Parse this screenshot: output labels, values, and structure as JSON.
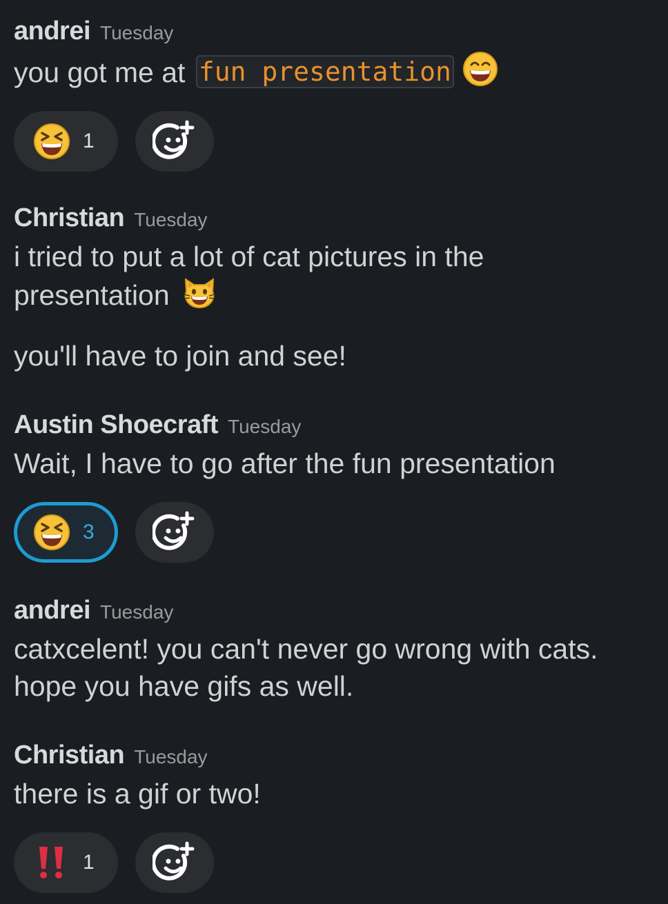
{
  "messages": [
    {
      "author": "andrei",
      "time": "Tuesday",
      "text_before": "you got me at",
      "code": "fun presentation",
      "emoji_after": "grinning-face-with-smiling-eyes",
      "reactions": [
        {
          "emoji": "laughing-face",
          "count": "1",
          "active": false
        }
      ]
    },
    {
      "author": "Christian",
      "time": "Tuesday",
      "lines": [
        "i tried to put a lot of cat pictures in the",
        "presentation"
      ],
      "emoji_after": "grinning-cat",
      "second_paragraph": "you'll have to join and see!"
    },
    {
      "author": "Austin Shoecraft",
      "time": "Tuesday",
      "lines": [
        "Wait, I have to go after the fun presentation"
      ],
      "reactions": [
        {
          "emoji": "laughing-face",
          "count": "3",
          "active": true
        }
      ]
    },
    {
      "author": "andrei",
      "time": "Tuesday",
      "lines": [
        "catxcelent! you can't never go wrong with cats.",
        "hope you have gifs as well."
      ]
    },
    {
      "author": "Christian",
      "time": "Tuesday",
      "lines": [
        "there is a gif or two!"
      ],
      "reactions": [
        {
          "emoji": "double-exclamation-mark",
          "count": "1",
          "active": false
        }
      ]
    }
  ],
  "colors": {
    "background": "#1a1d21",
    "text": "#d1d2d3",
    "timestamp": "#9a9b9d",
    "code_text": "#e8912d",
    "reaction_pill": "#2b2d31",
    "reaction_active_border": "#1d9bd1",
    "reaction_active_count": "#36a9e1"
  },
  "icons": {
    "add_reaction": "add-reaction-icon"
  }
}
